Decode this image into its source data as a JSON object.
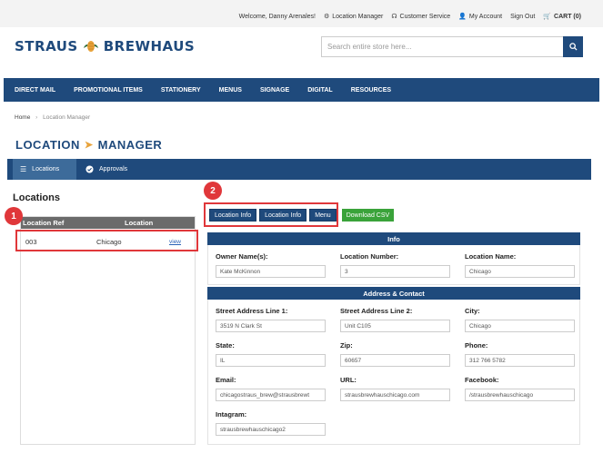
{
  "top_links": {
    "welcome": "Welcome, Danny Arenales!",
    "location_manager": "Location Manager",
    "customer_service": "Customer Service",
    "my_account": "My Account",
    "sign_out": "Sign Out",
    "cart": "CART (0)"
  },
  "brand": {
    "left": "STRAUS",
    "right": "BREWHAUS",
    "color": "#1f4a7c"
  },
  "search": {
    "placeholder": "Search entire store here..."
  },
  "nav": [
    "DIRECT MAIL",
    "PROMOTIONAL ITEMS",
    "STATIONERY",
    "MENUS",
    "SIGNAGE",
    "DIGITAL",
    "RESOURCES"
  ],
  "breadcrumb": {
    "home": "Home",
    "current": "Location Manager"
  },
  "page_title": {
    "left": "LOCATION",
    "right": "MANAGER"
  },
  "subtabs": {
    "locations": "Locations",
    "approvals": "Approvals"
  },
  "locations_heading": "Locations",
  "table": {
    "headers": {
      "ref": "Location Ref",
      "location": "Location"
    },
    "rows": [
      {
        "ref": "003",
        "location": "Chicago",
        "action": "view"
      }
    ]
  },
  "annotations": {
    "one": "1",
    "two": "2"
  },
  "buttons": {
    "location_info_1": "Location Info",
    "location_info_2": "Location Info",
    "menu": "Menu",
    "download_csv": "Download CSV"
  },
  "sections": {
    "info": "Info",
    "address_contact": "Address & Contact"
  },
  "info": {
    "owner": {
      "label": "Owner Name(s):",
      "value": "Kate McKinnon"
    },
    "number": {
      "label": "Location Number:",
      "value": "3"
    },
    "name": {
      "label": "Location Name:",
      "value": "Chicago"
    }
  },
  "address": {
    "street1": {
      "label": "Street Address Line 1:",
      "value": "3519 N Clark St"
    },
    "street2": {
      "label": "Street Address Line 2:",
      "value": "Unit C105"
    },
    "city": {
      "label": "City:",
      "value": "Chicago"
    },
    "state": {
      "label": "State:",
      "value": "IL"
    },
    "zip": {
      "label": "Zip:",
      "value": "60657"
    },
    "phone": {
      "label": "Phone:",
      "value": "312 766 5782"
    },
    "email": {
      "label": "Email:",
      "value": "chicagostraus_brew@strausbrewt"
    },
    "url": {
      "label": "URL:",
      "value": "strausbrewhauschicago.com"
    },
    "facebook": {
      "label": "Facebook:",
      "value": "/strausbrewhauschicago"
    },
    "instagram": {
      "label": "Intagram:",
      "value": "strausbrewhauschicago2"
    }
  },
  "colors": {
    "primary": "#1f4a7c",
    "highlight": "#e0373a",
    "csv": "#3aa33a",
    "accent": "#e8a33b"
  }
}
